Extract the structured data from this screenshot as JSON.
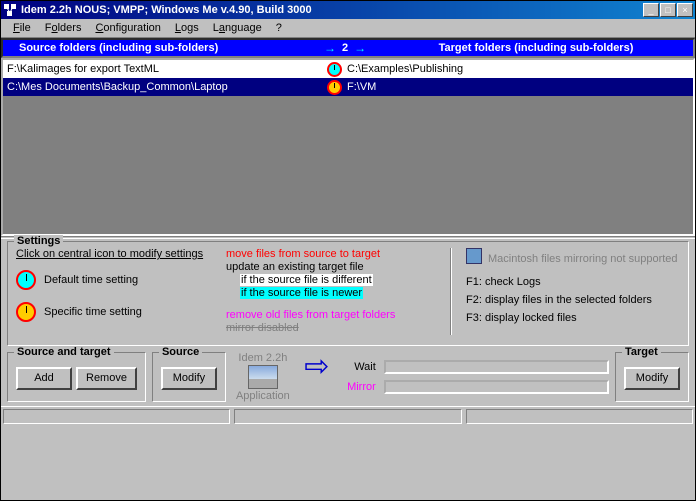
{
  "title": "Idem 2.2h    NOUS; VMPP; Windows Me v.4.90, Build 3000",
  "menu": {
    "file": "File",
    "folders": "Folders",
    "config": "Configuration",
    "logs": "Logs",
    "lang": "Language",
    "help": "?"
  },
  "header": {
    "source": "Source folders (including sub-folders)",
    "count": "2",
    "target": "Target folders (including sub-folders)"
  },
  "rows": [
    {
      "src": "F:\\Kalimages for export TextML",
      "tgt": "C:\\Examples\\Publishing"
    },
    {
      "src": "C:\\Mes Documents\\Backup_Common\\Laptop",
      "tgt": "F:\\VM"
    }
  ],
  "settings": {
    "legend": "Settings",
    "click_hint": "Click on central icon to modify settings",
    "default_time": "Default time setting",
    "specific_time": "Specific time setting",
    "move": "move files from source to target",
    "update": "update an existing target file",
    "if_diff": "if the source file is different",
    "if_newer": "if the source file is newer",
    "remove_old": "remove old files from target folders",
    "mirror_disabled": "mirror disabled",
    "mac": "Macintosh files mirroring not supported",
    "f1": "F1: check Logs",
    "f2": "F2: display files in the selected folders",
    "f3": "F3: display locked files"
  },
  "groups": {
    "src_tgt_legend": "Source and target",
    "add": "Add",
    "remove": "Remove",
    "source_legend": "Source",
    "modify": "Modify",
    "app_name": "Idem 2.2h",
    "app_label": "Application",
    "wait": "Wait",
    "mirror": "Mirror",
    "target_legend": "Target"
  }
}
